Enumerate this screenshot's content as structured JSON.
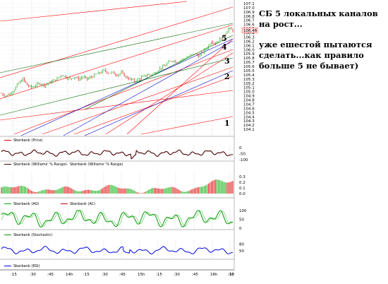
{
  "annotation": {
    "headline": "СБ 5 локальных каналов на рост...",
    "note": "уже ешестой пытаются сделать...как правило больше 5 не бывает)"
  },
  "colors": {
    "price_up": "#00aa00",
    "price_down": "#dd0000",
    "trend_red": "#ff0000",
    "trend_blue": "#0000cc",
    "trend_green": "#006600",
    "williams": "#4a0000",
    "stochastic": "#009900",
    "rsi": "#0000dd",
    "last_price_marker": "#ff0000"
  },
  "chart_data": [
    {
      "type": "candlestick",
      "panel": "price",
      "legend": "Sberbank (Price)",
      "y_ticks": [
        "107.1",
        "107.0",
        "106.9",
        "106.8",
        "106.7",
        "106.6",
        "106.5",
        "106.4",
        "106.3",
        "106.2",
        "106.1",
        "106.0",
        "105.9",
        "105.8",
        "105.7",
        "105.6",
        "105.5",
        "105.4",
        "105.3",
        "105.2",
        "105.1",
        "105.0",
        "104.9",
        "104.8",
        "104.7",
        "104.6",
        "104.5",
        "104.4",
        "104.3",
        "104.2",
        "104.1"
      ],
      "ylim": [
        104.0,
        107.15
      ],
      "last_price_label": "106.46",
      "channel_numbers": [
        "1",
        "2",
        "3",
        "4",
        "5"
      ],
      "close_path": [
        [
          0,
          104.95
        ],
        [
          6,
          104.9
        ],
        [
          12,
          104.95
        ],
        [
          18,
          105.05
        ],
        [
          24,
          105.2
        ],
        [
          30,
          105.3
        ],
        [
          36,
          105.15
        ],
        [
          42,
          105.1
        ],
        [
          48,
          105.15
        ],
        [
          54,
          105.2
        ],
        [
          60,
          105.15
        ],
        [
          66,
          105.2
        ],
        [
          72,
          105.25
        ],
        [
          78,
          105.3
        ],
        [
          84,
          105.4
        ],
        [
          90,
          105.35
        ],
        [
          96,
          105.3
        ],
        [
          102,
          105.35
        ],
        [
          108,
          105.3
        ],
        [
          114,
          105.35
        ],
        [
          120,
          105.3
        ],
        [
          126,
          105.35
        ],
        [
          132,
          105.4
        ],
        [
          138,
          105.45
        ],
        [
          144,
          105.5
        ],
        [
          150,
          105.45
        ],
        [
          156,
          105.45
        ],
        [
          162,
          105.4
        ],
        [
          168,
          105.45
        ],
        [
          174,
          105.35
        ],
        [
          180,
          105.3
        ],
        [
          186,
          105.25
        ],
        [
          192,
          105.3
        ],
        [
          198,
          105.35
        ],
        [
          204,
          105.4
        ],
        [
          210,
          105.4
        ],
        [
          216,
          105.45
        ],
        [
          222,
          105.55
        ],
        [
          228,
          105.6
        ],
        [
          234,
          105.7
        ],
        [
          240,
          105.75
        ],
        [
          246,
          105.7
        ],
        [
          252,
          105.75
        ],
        [
          258,
          105.8
        ],
        [
          264,
          105.85
        ],
        [
          270,
          105.9
        ],
        [
          276,
          105.85
        ],
        [
          282,
          105.95
        ],
        [
          288,
          106.05
        ],
        [
          294,
          106.2
        ],
        [
          300,
          106.15
        ],
        [
          306,
          106.25
        ],
        [
          312,
          106.35
        ],
        [
          318,
          106.5
        ],
        [
          324,
          106.46
        ]
      ]
    },
    {
      "type": "line",
      "panel": "williams",
      "legend": [
        "Sberbank (Williams' % Range)",
        "Sberbank (Williams' % Range)"
      ],
      "y_ticks": [
        "0",
        "-50",
        "-100"
      ],
      "ylim": [
        -100,
        0
      ]
    },
    {
      "type": "bar",
      "panel": "ao",
      "legend": [
        "Sberbank (AO)",
        "Sberbank (AC)"
      ],
      "y_ticks": [
        "0.3",
        "0.2",
        "0.1",
        "0.0"
      ],
      "ylim": [
        -0.05,
        0.35
      ]
    },
    {
      "type": "line",
      "panel": "stochastic",
      "legend": "Sberbank (Stochastic)",
      "y_ticks": [
        "100",
        "50",
        "0"
      ],
      "ylim": [
        0,
        100
      ]
    },
    {
      "type": "line",
      "panel": "rsi",
      "legend": "Sberbank (RSI)",
      "y_ticks": [
        "80",
        "50"
      ],
      "ylim": [
        20,
        90
      ]
    }
  ],
  "x_ticks": [
    ":15",
    ":30",
    ":45",
    "14h",
    ":15",
    ":30",
    ":45",
    "15h",
    ":15",
    ":30",
    ":45",
    "16h",
    ":15",
    ":30"
  ]
}
